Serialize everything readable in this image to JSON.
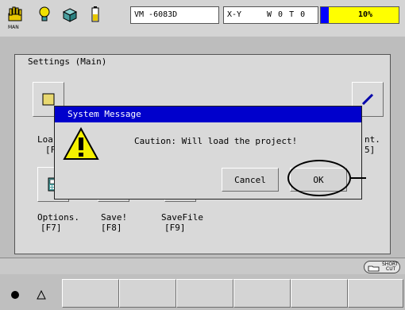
{
  "topbar": {
    "man_label": "MAN",
    "robot": "VM  -6083D",
    "coord_system": "X-Y",
    "tool_status": "W 0 T 0",
    "speed": "10%",
    "speed_fraction": 0.1,
    "speed_color": "#ffff00"
  },
  "settings": {
    "title": "Settings (Main)",
    "items": [
      {
        "label": "Options.",
        "key": "[F7]",
        "icon": "options-icon"
      },
      {
        "label": "Save!",
        "key": "[F8]",
        "icon": "folder-icon"
      },
      {
        "label": "SaveFile",
        "key": "[F9]",
        "icon": "folder-icon"
      }
    ],
    "partial_left_label": "Loa",
    "partial_left_key": "[F",
    "partial_right_label": "nt.",
    "partial_right_key": "5]"
  },
  "dialog": {
    "title": "System Message",
    "message": "Caution: Will load the project!",
    "cancel_label": "Cancel",
    "ok_label": "OK",
    "title_color": "#0000cc"
  },
  "statusbar": {
    "shortcut_label_1": "SHORT",
    "shortcut_label_2": "CUT"
  }
}
